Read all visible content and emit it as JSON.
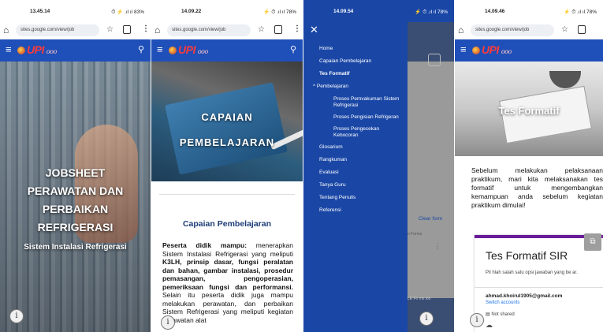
{
  "phone1": {
    "status": {
      "time": "13.45.14",
      "icons": "⏱ ⚡ .ıl ıl 83%"
    },
    "browser": {
      "url": "sites.google.com/view/job"
    },
    "site": {
      "logo": "UPI",
      "logo_script": "ooo"
    },
    "hero": {
      "title_lines": [
        "JOBSHEET",
        "PERAWATAN DAN",
        "PERBAIKAN",
        "REFRIGERASI"
      ],
      "subtitle": "Sistem Instalasi Refrigerasi"
    }
  },
  "phone2": {
    "status": {
      "time": "14.09.22",
      "icons": "⚡ ⏱ .ıl ıl 78%"
    },
    "browser": {
      "url": "sites.google.com/view/job"
    },
    "site": {
      "logo": "UPI",
      "logo_script": "ooo"
    },
    "hero": {
      "title_lines": [
        "CAPAIAN",
        "PEMBELAJARAN"
      ]
    },
    "section_title": "Capaian Pembelajaran",
    "paragraph": {
      "lead": "Peserta didik mampu:",
      "text1": " menerapkan Sistem Instalasi Refrigerasi yang meliputi ",
      "bold1": "K3LH, prinsip dasar, fungsi peralatan dan bahan, gambar instalasi, prosedur pemasangan, pengoperasian, pemeriksaan fungsi dan performansi.",
      "text2": " Selain itu peserta didik juga mampu melakukan perawatan, dan perbaikan Sistem Refrigerasi yang meliputi kegiatan perawatan alat"
    }
  },
  "phone3": {
    "status": {
      "time": "14.09.54",
      "icons": "⚡ ⏱ .ıl ıl 78%"
    },
    "menu": [
      {
        "label": "Home",
        "type": "item"
      },
      {
        "label": "Capaian Pembelajaran",
        "type": "item"
      },
      {
        "label": "Tes Formatif",
        "type": "active"
      },
      {
        "label": "^ Pembelajaran",
        "type": "sect"
      },
      {
        "label": "Proses Pemvakuman Sistem Refrigerasi",
        "type": "sub"
      },
      {
        "label": "Proses Pengisian Refrigeran",
        "type": "sub"
      },
      {
        "label": "Proses Pengecekan Kebocoran",
        "type": "sub"
      },
      {
        "label": "Glosarium",
        "type": "item"
      },
      {
        "label": "Rangkuman",
        "type": "item"
      },
      {
        "label": "Evaluasi",
        "type": "item"
      },
      {
        "label": "Tanya Guru",
        "type": "item"
      },
      {
        "label": "Tentang Penulis",
        "type": "item"
      },
      {
        "label": "Referensi",
        "type": "item"
      }
    ],
    "behind": {
      "clear": "Clear form",
      "fade": "n Forms",
      "footer": "LE Fo ms ion"
    }
  },
  "phone4": {
    "status": {
      "time": "14.09.46",
      "icons": "⚡ ⏱ .ıl ıl 78%"
    },
    "browser": {
      "url": "sites.google.com/view/job"
    },
    "site": {
      "logo": "UPI",
      "logo_script": "ooo"
    },
    "hero": {
      "title": "Tes Formatif"
    },
    "intro": "Sebelum melakukan pelaksanaan praktikum, mari kita melaksanakan tes formatif untuk mengembangkan kemampuan anda sebelum kegiatan praktikum dimulai!",
    "form": {
      "title": "Tes Formatif SIR",
      "description": "Pil hlah salah satu opsi jawaban yang be ar.",
      "email": "ahmad.khoirul1905@gmail.com",
      "switch": "Switch accounts",
      "not_shared": "Not shared"
    }
  }
}
